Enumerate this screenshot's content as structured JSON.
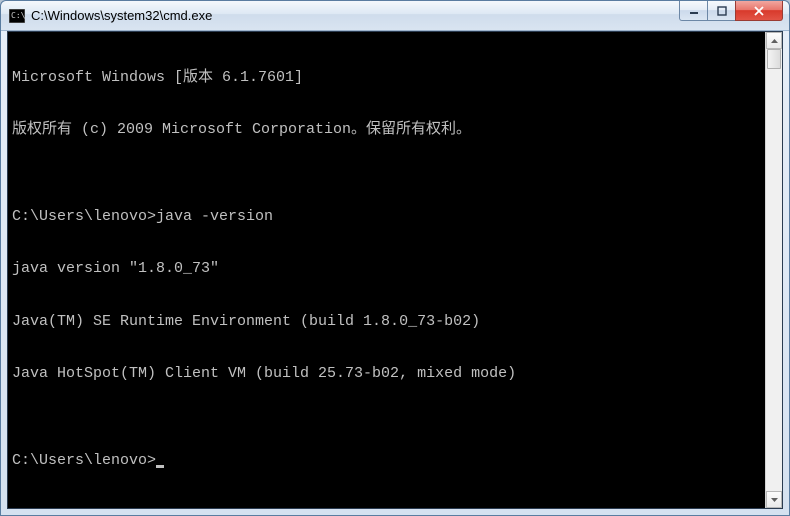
{
  "window": {
    "title": "C:\\Windows\\system32\\cmd.exe"
  },
  "console": {
    "lines": [
      "Microsoft Windows [版本 6.1.7601]",
      "版权所有 (c) 2009 Microsoft Corporation。保留所有权利。",
      "",
      "C:\\Users\\lenovo>java -version",
      "java version \"1.8.0_73\"",
      "Java(TM) SE Runtime Environment (build 1.8.0_73-b02)",
      "Java HotSpot(TM) Client VM (build 25.73-b02, mixed mode)",
      ""
    ],
    "prompt": "C:\\Users\\lenovo>"
  }
}
